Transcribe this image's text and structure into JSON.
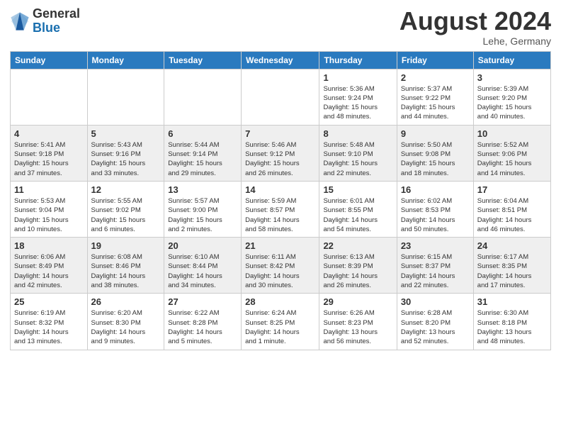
{
  "logo": {
    "general": "General",
    "blue": "Blue"
  },
  "title": {
    "month_year": "August 2024",
    "location": "Lehe, Germany"
  },
  "headers": [
    "Sunday",
    "Monday",
    "Tuesday",
    "Wednesday",
    "Thursday",
    "Friday",
    "Saturday"
  ],
  "weeks": [
    [
      {
        "day": "",
        "info": ""
      },
      {
        "day": "",
        "info": ""
      },
      {
        "day": "",
        "info": ""
      },
      {
        "day": "",
        "info": ""
      },
      {
        "day": "1",
        "info": "Sunrise: 5:36 AM\nSunset: 9:24 PM\nDaylight: 15 hours\nand 48 minutes."
      },
      {
        "day": "2",
        "info": "Sunrise: 5:37 AM\nSunset: 9:22 PM\nDaylight: 15 hours\nand 44 minutes."
      },
      {
        "day": "3",
        "info": "Sunrise: 5:39 AM\nSunset: 9:20 PM\nDaylight: 15 hours\nand 40 minutes."
      }
    ],
    [
      {
        "day": "4",
        "info": "Sunrise: 5:41 AM\nSunset: 9:18 PM\nDaylight: 15 hours\nand 37 minutes."
      },
      {
        "day": "5",
        "info": "Sunrise: 5:43 AM\nSunset: 9:16 PM\nDaylight: 15 hours\nand 33 minutes."
      },
      {
        "day": "6",
        "info": "Sunrise: 5:44 AM\nSunset: 9:14 PM\nDaylight: 15 hours\nand 29 minutes."
      },
      {
        "day": "7",
        "info": "Sunrise: 5:46 AM\nSunset: 9:12 PM\nDaylight: 15 hours\nand 26 minutes."
      },
      {
        "day": "8",
        "info": "Sunrise: 5:48 AM\nSunset: 9:10 PM\nDaylight: 15 hours\nand 22 minutes."
      },
      {
        "day": "9",
        "info": "Sunrise: 5:50 AM\nSunset: 9:08 PM\nDaylight: 15 hours\nand 18 minutes."
      },
      {
        "day": "10",
        "info": "Sunrise: 5:52 AM\nSunset: 9:06 PM\nDaylight: 15 hours\nand 14 minutes."
      }
    ],
    [
      {
        "day": "11",
        "info": "Sunrise: 5:53 AM\nSunset: 9:04 PM\nDaylight: 15 hours\nand 10 minutes."
      },
      {
        "day": "12",
        "info": "Sunrise: 5:55 AM\nSunset: 9:02 PM\nDaylight: 15 hours\nand 6 minutes."
      },
      {
        "day": "13",
        "info": "Sunrise: 5:57 AM\nSunset: 9:00 PM\nDaylight: 15 hours\nand 2 minutes."
      },
      {
        "day": "14",
        "info": "Sunrise: 5:59 AM\nSunset: 8:57 PM\nDaylight: 14 hours\nand 58 minutes."
      },
      {
        "day": "15",
        "info": "Sunrise: 6:01 AM\nSunset: 8:55 PM\nDaylight: 14 hours\nand 54 minutes."
      },
      {
        "day": "16",
        "info": "Sunrise: 6:02 AM\nSunset: 8:53 PM\nDaylight: 14 hours\nand 50 minutes."
      },
      {
        "day": "17",
        "info": "Sunrise: 6:04 AM\nSunset: 8:51 PM\nDaylight: 14 hours\nand 46 minutes."
      }
    ],
    [
      {
        "day": "18",
        "info": "Sunrise: 6:06 AM\nSunset: 8:49 PM\nDaylight: 14 hours\nand 42 minutes."
      },
      {
        "day": "19",
        "info": "Sunrise: 6:08 AM\nSunset: 8:46 PM\nDaylight: 14 hours\nand 38 minutes."
      },
      {
        "day": "20",
        "info": "Sunrise: 6:10 AM\nSunset: 8:44 PM\nDaylight: 14 hours\nand 34 minutes."
      },
      {
        "day": "21",
        "info": "Sunrise: 6:11 AM\nSunset: 8:42 PM\nDaylight: 14 hours\nand 30 minutes."
      },
      {
        "day": "22",
        "info": "Sunrise: 6:13 AM\nSunset: 8:39 PM\nDaylight: 14 hours\nand 26 minutes."
      },
      {
        "day": "23",
        "info": "Sunrise: 6:15 AM\nSunset: 8:37 PM\nDaylight: 14 hours\nand 22 minutes."
      },
      {
        "day": "24",
        "info": "Sunrise: 6:17 AM\nSunset: 8:35 PM\nDaylight: 14 hours\nand 17 minutes."
      }
    ],
    [
      {
        "day": "25",
        "info": "Sunrise: 6:19 AM\nSunset: 8:32 PM\nDaylight: 14 hours\nand 13 minutes."
      },
      {
        "day": "26",
        "info": "Sunrise: 6:20 AM\nSunset: 8:30 PM\nDaylight: 14 hours\nand 9 minutes."
      },
      {
        "day": "27",
        "info": "Sunrise: 6:22 AM\nSunset: 8:28 PM\nDaylight: 14 hours\nand 5 minutes."
      },
      {
        "day": "28",
        "info": "Sunrise: 6:24 AM\nSunset: 8:25 PM\nDaylight: 14 hours\nand 1 minute."
      },
      {
        "day": "29",
        "info": "Sunrise: 6:26 AM\nSunset: 8:23 PM\nDaylight: 13 hours\nand 56 minutes."
      },
      {
        "day": "30",
        "info": "Sunrise: 6:28 AM\nSunset: 8:20 PM\nDaylight: 13 hours\nand 52 minutes."
      },
      {
        "day": "31",
        "info": "Sunrise: 6:30 AM\nSunset: 8:18 PM\nDaylight: 13 hours\nand 48 minutes."
      }
    ]
  ]
}
